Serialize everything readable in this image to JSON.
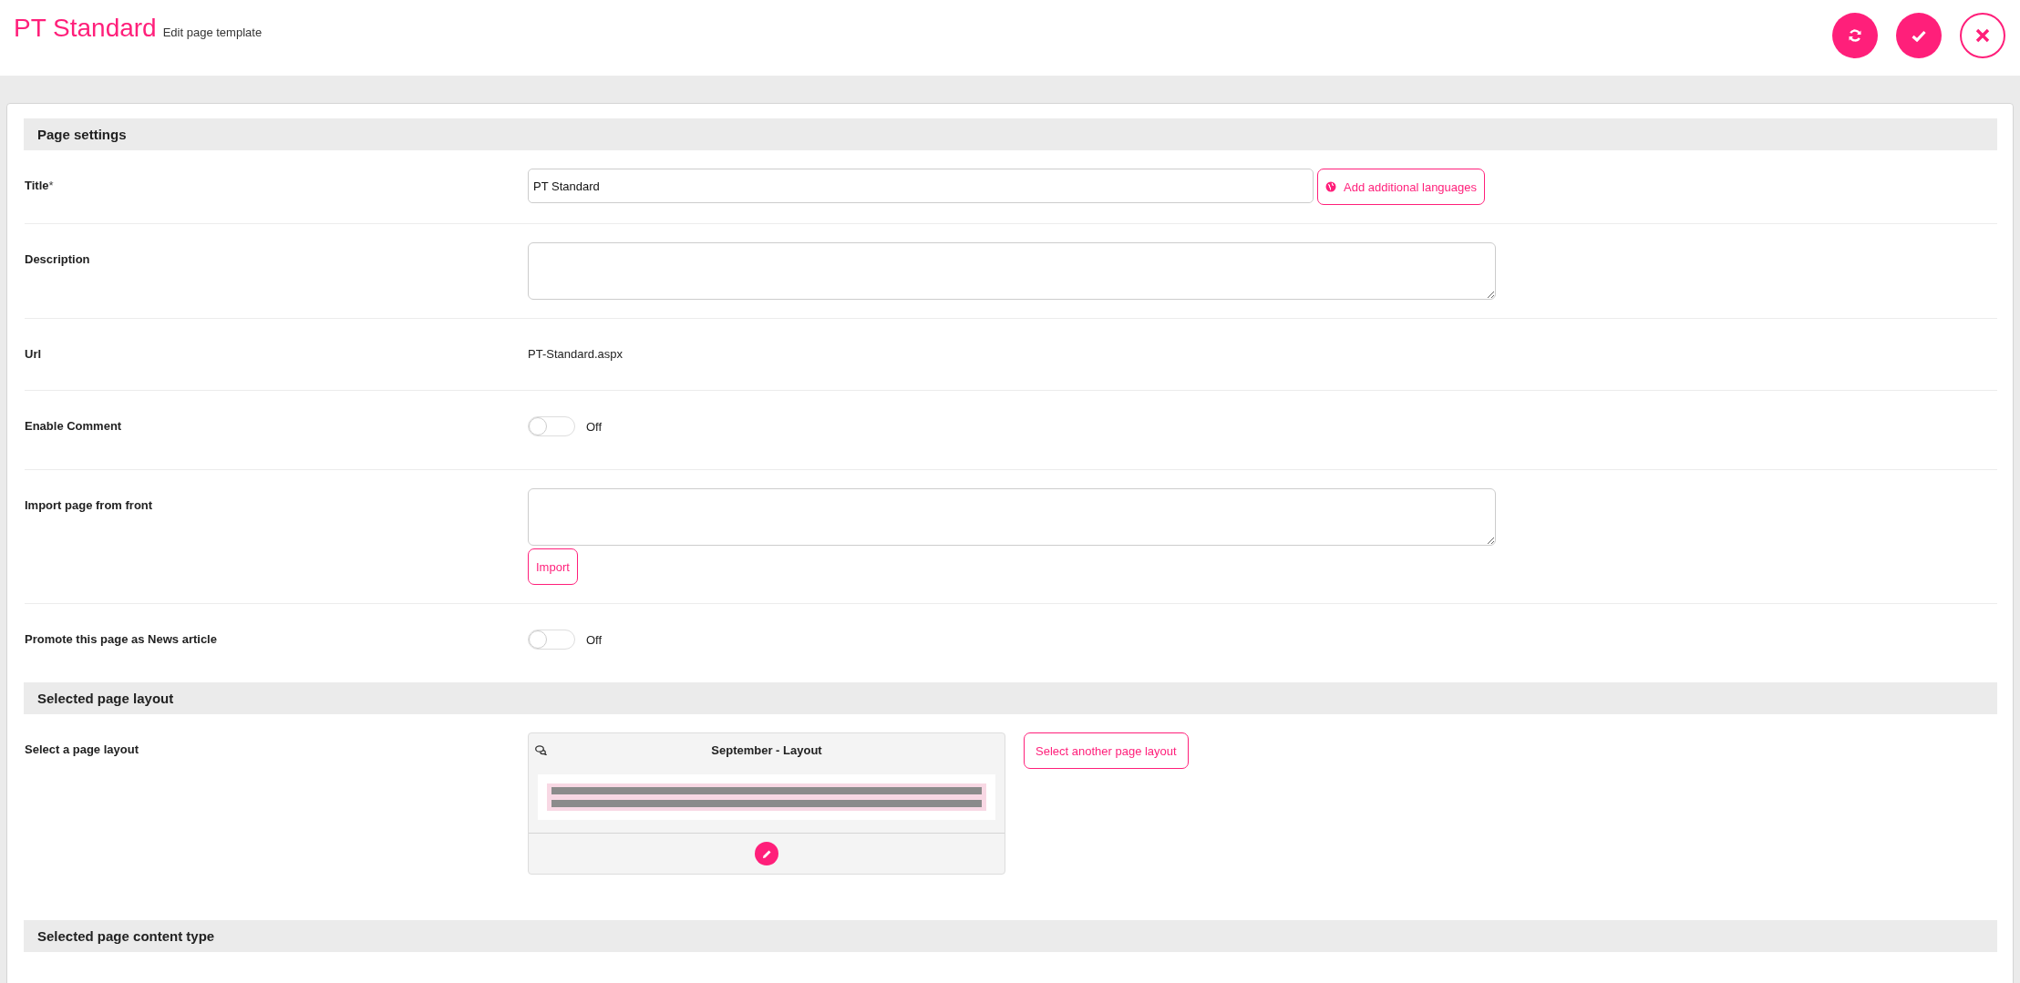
{
  "header": {
    "title": "PT Standard",
    "subtitle": "Edit page template",
    "actions": [
      {
        "kind": "refresh"
      },
      {
        "kind": "save"
      },
      {
        "kind": "close"
      }
    ]
  },
  "sections": [
    {
      "title": "Page settings",
      "rows": [
        {
          "kind": "input",
          "label": "Title",
          "required_mark": "*",
          "value": "PT Standard",
          "button": "Add additional languages"
        },
        {
          "kind": "textarea",
          "label": "Description"
        },
        {
          "kind": "text",
          "label": "Url",
          "value": "PT-Standard.aspx"
        },
        {
          "kind": "toggle",
          "label": "Enable Comment",
          "on": false,
          "state_label": "Off"
        },
        {
          "kind": "textarea",
          "label": "Import page from front",
          "button": "Import"
        },
        {
          "kind": "toggle",
          "label": "Promote this page as News article",
          "on": false,
          "state_label": "Off"
        }
      ]
    },
    {
      "title": "Selected page layout",
      "rows": [
        {
          "kind": "layout",
          "label": "Select a page layout",
          "layout_name": "September - Layout",
          "button": "Select another page layout"
        }
      ]
    },
    {
      "title": "Selected page content type"
    }
  ]
}
